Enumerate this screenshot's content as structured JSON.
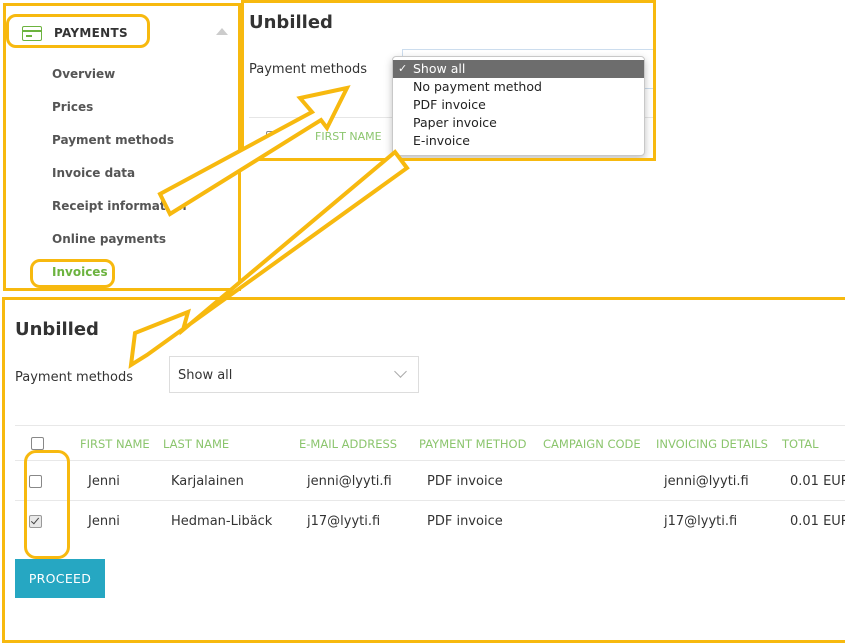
{
  "sidebar": {
    "title": "PAYMENTS",
    "items": [
      "Overview",
      "Prices",
      "Payment methods",
      "Invoice data",
      "Receipt information",
      "Online payments",
      "Invoices"
    ]
  },
  "top": {
    "title": "Unbilled",
    "pm_label": "Payment methods",
    "first_name_header": "FIRST NAME",
    "dropdown_options": [
      "Show all",
      "No payment method",
      "PDF invoice",
      "Paper invoice",
      "E-invoice"
    ],
    "selected": "Show all"
  },
  "bottom": {
    "title": "Unbilled",
    "pm_label": "Payment methods",
    "select_value": "Show all",
    "headers": {
      "first_name": "FIRST NAME",
      "last_name": "LAST NAME",
      "email": "E-MAIL ADDRESS",
      "payment_method": "PAYMENT METHOD",
      "campaign_code": "CAMPAIGN CODE",
      "invoicing_details": "INVOICING DETAILS",
      "total": "TOTAL"
    },
    "rows": [
      {
        "first": "Jenni",
        "last": "Karjalainen",
        "email": "jenni@lyyti.fi",
        "method": "PDF invoice",
        "campaign": "",
        "invoicing": "jenni@lyyti.fi",
        "total": "0.01 EUR",
        "checked": false
      },
      {
        "first": "Jenni",
        "last": "Hedman-Libäck",
        "email": "j17@lyyti.fi",
        "method": "PDF invoice",
        "campaign": "",
        "invoicing": "j17@lyyti.fi",
        "total": "0.01 EUR",
        "checked": true
      }
    ],
    "proceed_label": "PROCEED"
  },
  "colors": {
    "highlight": "#f7b90f",
    "accent_green": "#6cb33f",
    "button": "#26a7c2"
  }
}
